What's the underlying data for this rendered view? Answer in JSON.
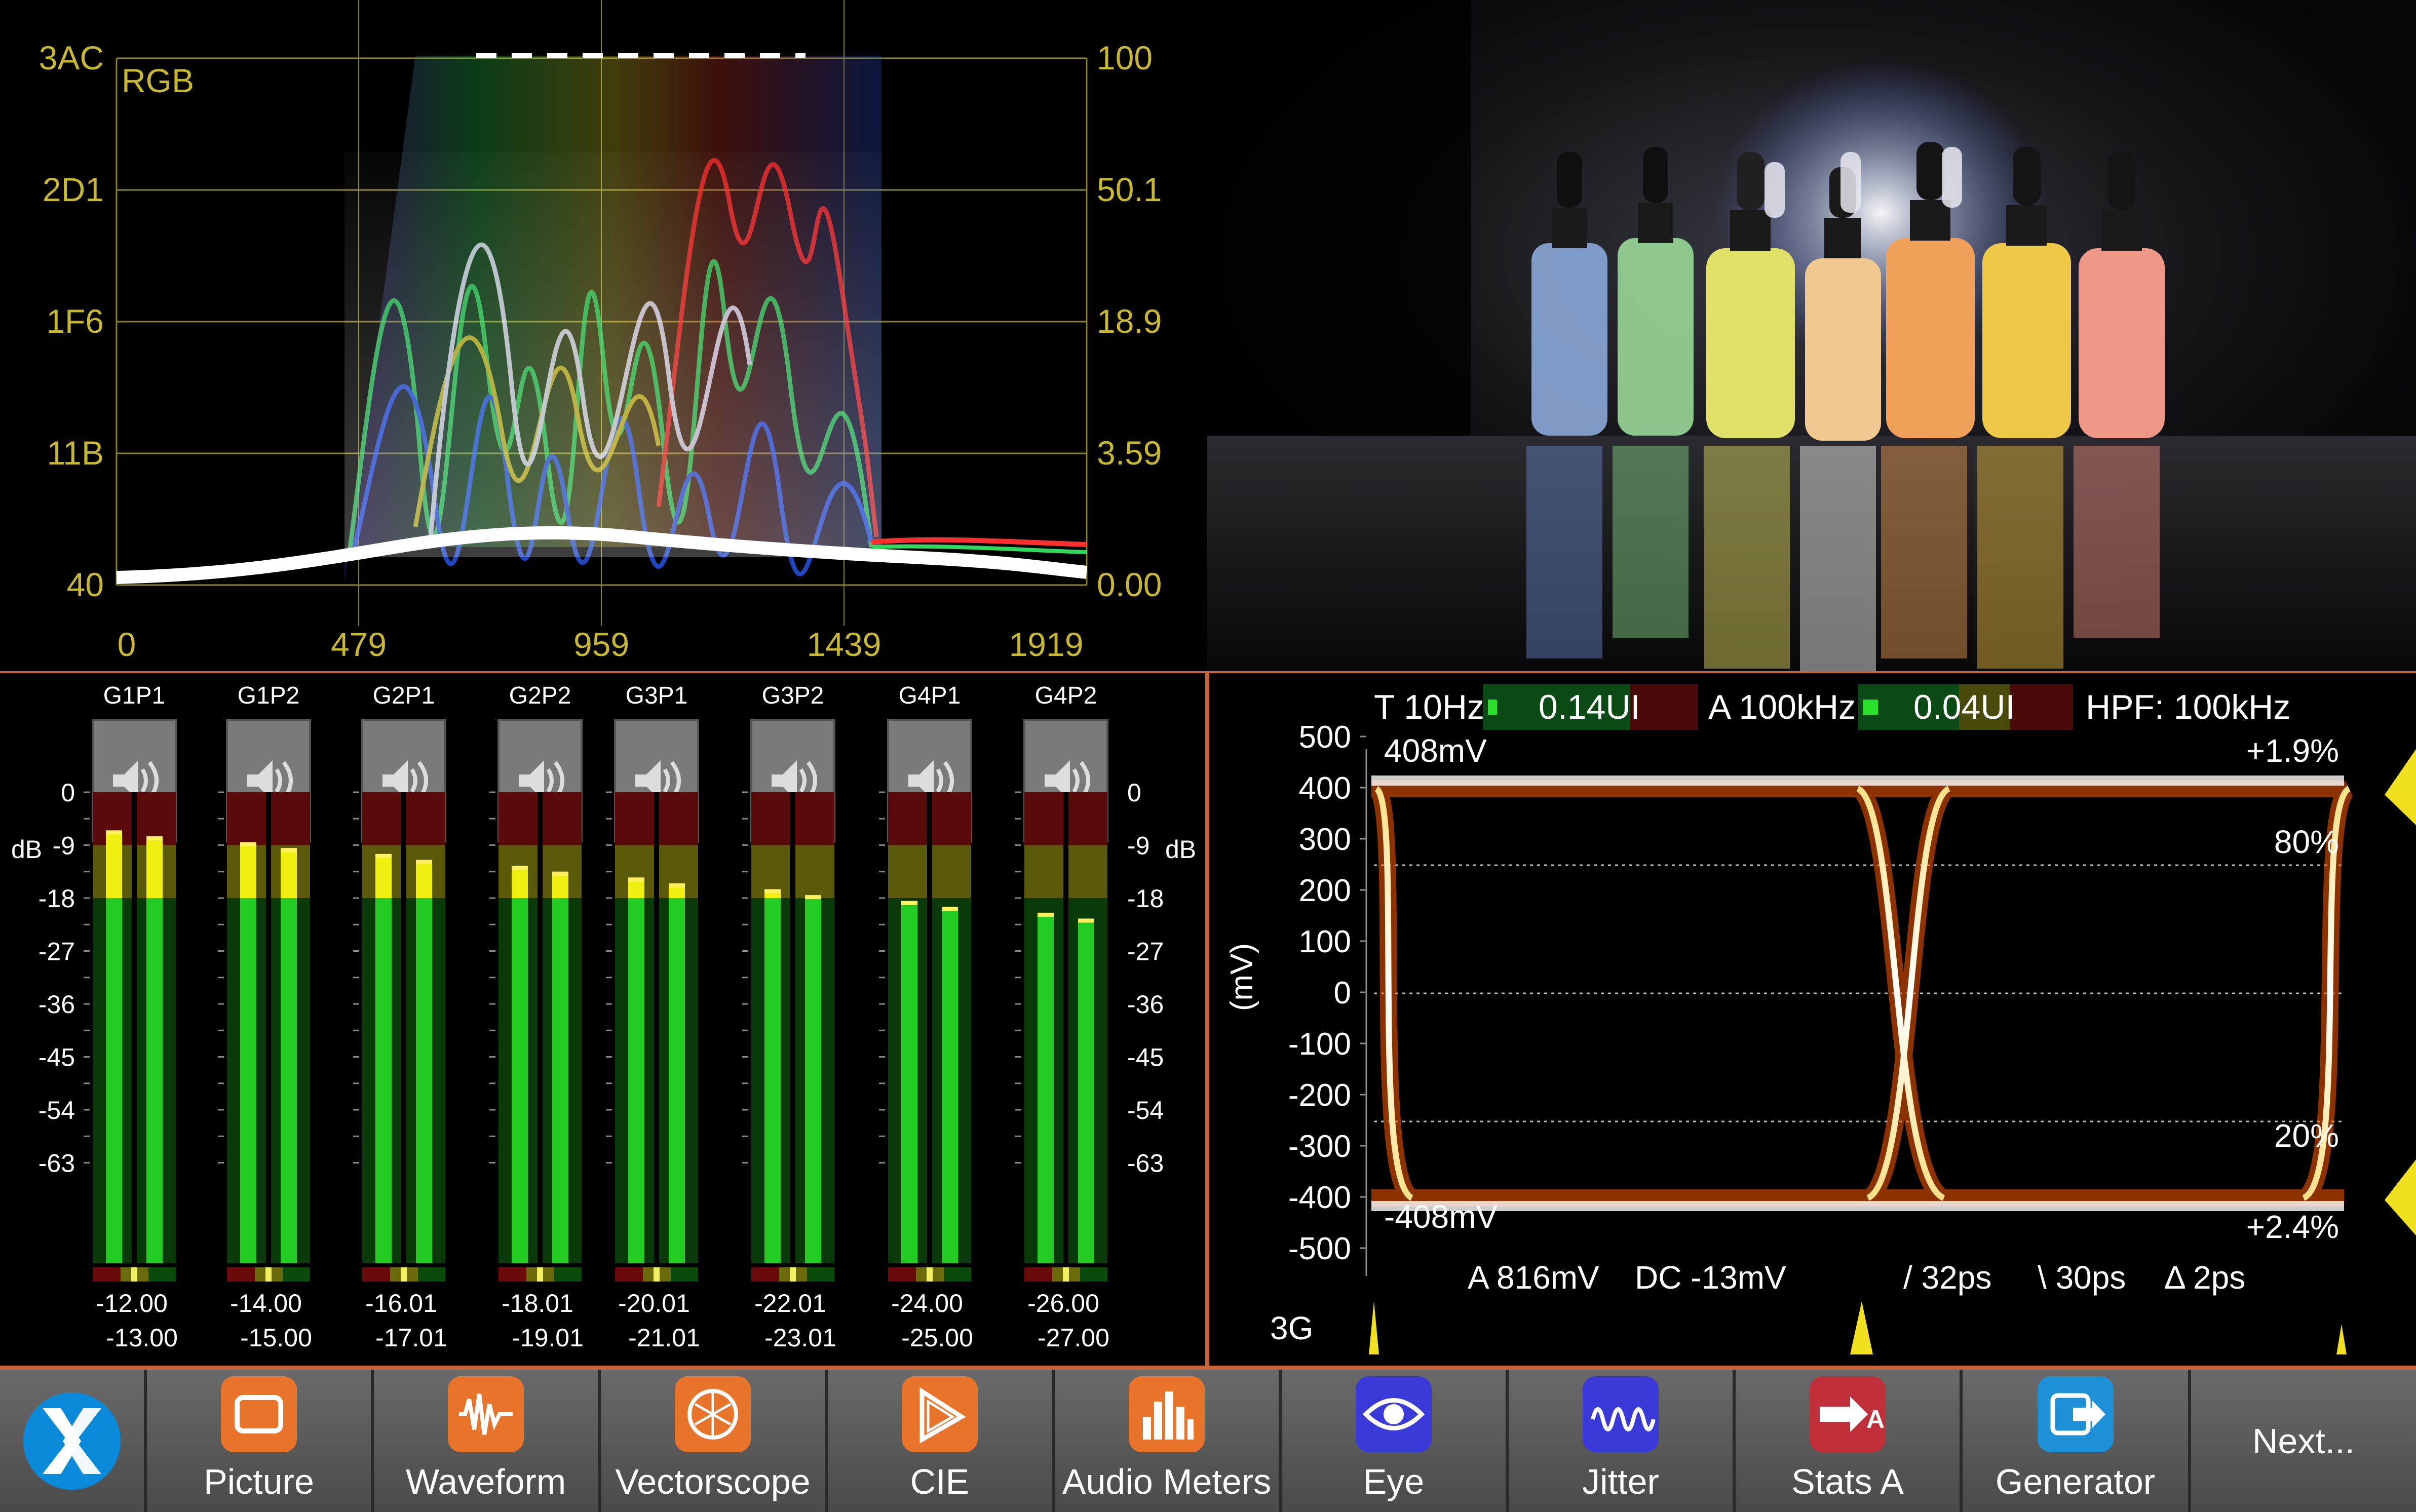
{
  "waveform": {
    "mode_label": "RGB",
    "left_axis": [
      "3AC",
      "2D1",
      "1F6",
      "11B",
      "40"
    ],
    "right_axis": [
      "100",
      "50.1",
      "18.9",
      "3.59",
      "0.00"
    ],
    "x_axis": [
      "0",
      "479",
      "959",
      "1439",
      "1919"
    ]
  },
  "audio": {
    "db_label": "dB",
    "scale": [
      "0",
      "-9",
      "-18",
      "-27",
      "-36",
      "-45",
      "-54",
      "-63"
    ],
    "channels": [
      {
        "name": "G1P1",
        "l": "-12.00",
        "r": "-13.00"
      },
      {
        "name": "G1P2",
        "l": "-14.00",
        "r": "-15.00"
      },
      {
        "name": "G2P1",
        "l": "-16.01",
        "r": "-17.01"
      },
      {
        "name": "G2P2",
        "l": "-18.01",
        "r": "-19.01"
      },
      {
        "name": "G3P1",
        "l": "-20.01",
        "r": "-21.01"
      },
      {
        "name": "G3P2",
        "l": "-22.01",
        "r": "-23.01"
      },
      {
        "name": "G4P1",
        "l": "-24.00",
        "r": "-25.00"
      },
      {
        "name": "G4P2",
        "l": "-26.00",
        "r": "-27.00"
      }
    ],
    "speaker_icon": "speaker-icon"
  },
  "eye": {
    "t_label": "T 10Hz",
    "t_value": "0.14UI",
    "a_label": "A 100kHz",
    "a_value": "0.04UI",
    "hpf": "HPF: 100kHz",
    "y_axis": [
      "500",
      "400",
      "300",
      "200",
      "100",
      "0",
      "-100",
      "-200",
      "-300",
      "-400",
      "-500"
    ],
    "y_unit": "(mV)",
    "top_mv": "408mV",
    "bottom_mv": "-408mV",
    "pct_top": "+1.9%",
    "pct_80": "80%",
    "pct_20": "20%",
    "pct_bottom": "+2.4%",
    "amplitude": "A 816mV",
    "dc": "DC -13mV",
    "rise": "/ 32ps",
    "fall": "\\ 30ps",
    "delta": "Δ 2ps",
    "standard": "3G"
  },
  "toolbar": {
    "logo_icon": "app-logo-icon",
    "buttons": [
      {
        "label": "Picture",
        "icon": "picture-icon",
        "color": "#e8742c"
      },
      {
        "label": "Waveform",
        "icon": "waveform-icon",
        "color": "#e8742c"
      },
      {
        "label": "Vectorscope",
        "icon": "vectorscope-icon",
        "color": "#e8742c"
      },
      {
        "label": "CIE",
        "icon": "cie-icon",
        "color": "#e8742c"
      },
      {
        "label": "Audio Meters",
        "icon": "audio-meters-icon",
        "color": "#e8742c"
      },
      {
        "label": "Eye",
        "icon": "eye-icon",
        "color": "#3a3ad8"
      },
      {
        "label": "Jitter",
        "icon": "jitter-icon",
        "color": "#3a3ad8"
      },
      {
        "label": "Stats A",
        "icon": "stats-icon",
        "color": "#c0303a"
      },
      {
        "label": "Generator",
        "icon": "generator-icon",
        "color": "#1e90d8"
      }
    ],
    "next_label": "Next..."
  }
}
